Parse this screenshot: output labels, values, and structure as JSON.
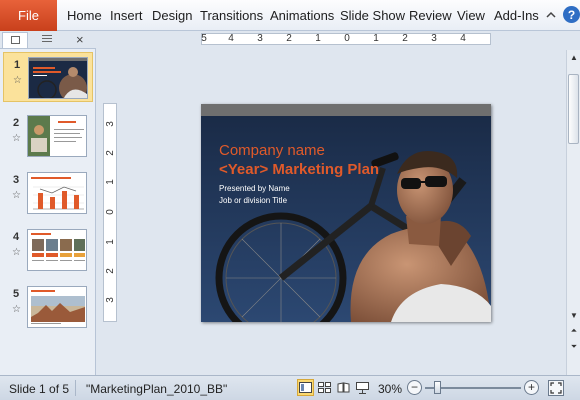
{
  "ribbon": {
    "file_tab": "File",
    "tabs": [
      "Home",
      "Insert",
      "Design",
      "Transitions",
      "Animations",
      "Slide Show",
      "Review",
      "View",
      "Add-Ins"
    ],
    "help_glyph": "?",
    "icons": {
      "collapse": "chevron-up-icon",
      "help": "help-icon"
    }
  },
  "slide_pane": {
    "close_glyph": "×",
    "thumbnails": [
      {
        "number": "1",
        "selected": true
      },
      {
        "number": "2",
        "selected": false
      },
      {
        "number": "3",
        "selected": false
      },
      {
        "number": "4",
        "selected": false
      },
      {
        "number": "5",
        "selected": false
      }
    ],
    "transition_icon": "star-icon"
  },
  "ruler": {
    "horizontal_ticks": [
      "5",
      "4",
      "3",
      "2",
      "1",
      "0",
      "1",
      "2",
      "3",
      "4"
    ],
    "vertical_ticks": [
      "3",
      "2",
      "1",
      "0",
      "1",
      "2",
      "3"
    ]
  },
  "slide": {
    "title_line_1": "Company name",
    "title_line_2": "<Year> Marketing Plan",
    "subtitle_line_1": "Presented by Name",
    "subtitle_line_2": "Job or division Title",
    "colors": {
      "title": "#e05a2a",
      "background": "#1b2a44"
    }
  },
  "status_bar": {
    "slide_indicator": "Slide 1 of 5",
    "theme_name": "\"MarketingPlan_2010_BB\"",
    "zoom": "30%",
    "zoom_out": "−",
    "zoom_in": "+",
    "view_buttons": [
      "normal-view-icon",
      "slide-sorter-icon",
      "reading-view-icon",
      "slide-show-icon"
    ],
    "active_view": "normal-view-icon",
    "zoom_slider_fraction": 0.13
  },
  "colors": {
    "file_tab": "#d5512a",
    "selection": "#fbe29b"
  }
}
